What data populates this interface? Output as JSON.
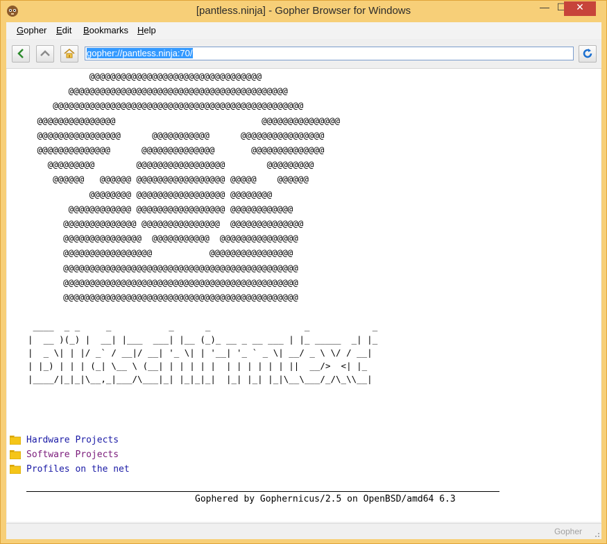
{
  "window": {
    "title": "[pantless.ninja] - Gopher Browser for Windows",
    "controls": {
      "minimize": "—",
      "maximize": "☐",
      "close": "✕"
    }
  },
  "menu": [
    {
      "label": "Gopher",
      "accel": "G",
      "rest": "opher"
    },
    {
      "label": "Edit",
      "accel": "E",
      "rest": "dit"
    },
    {
      "label": "Bookmarks",
      "accel": "B",
      "rest": "ookmarks"
    },
    {
      "label": "Help",
      "accel": "H",
      "rest": "elp"
    }
  ],
  "toolbar": {
    "back_icon": "arrow-left-icon",
    "up_icon": "chevron-up-icon",
    "home_icon": "home-icon",
    "refresh_icon": "refresh-icon",
    "address": "gopher://pantless.ninja:70/"
  },
  "art": {
    "skull": "           @@@@@@@@@@@@@@@@@@@@@@@@@@@@@@@@@\n       @@@@@@@@@@@@@@@@@@@@@@@@@@@@@@@@@@@@@@@@@@\n    @@@@@@@@@@@@@@@@@@@@@@@@@@@@@@@@@@@@@@@@@@@@@@@@\n @@@@@@@@@@@@@@@                            @@@@@@@@@@@@@@@\n @@@@@@@@@@@@@@@@      @@@@@@@@@@@      @@@@@@@@@@@@@@@@\n @@@@@@@@@@@@@@      @@@@@@@@@@@@@@       @@@@@@@@@@@@@@\n   @@@@@@@@@        @@@@@@@@@@@@@@@@@        @@@@@@@@@\n    @@@@@@   @@@@@@ @@@@@@@@@@@@@@@@@ @@@@@    @@@@@@\n           @@@@@@@@ @@@@@@@@@@@@@@@@@ @@@@@@@@\n       @@@@@@@@@@@@ @@@@@@@@@@@@@@@@@ @@@@@@@@@@@@\n      @@@@@@@@@@@@@@ @@@@@@@@@@@@@@@  @@@@@@@@@@@@@@\n      @@@@@@@@@@@@@@@  @@@@@@@@@@@  @@@@@@@@@@@@@@@\n      @@@@@@@@@@@@@@@@@           @@@@@@@@@@@@@@@@\n      @@@@@@@@@@@@@@@@@@@@@@@@@@@@@@@@@@@@@@@@@@@@@\n      @@@@@@@@@@@@@@@@@@@@@@@@@@@@@@@@@@@@@@@@@@@@@\n      @@@@@@@@@@@@@@@@@@@@@@@@@@@@@@@@@@@@@@@@@@@@@",
    "banner": " ____  _ _     _           _      _                  _            _\n|  __ )(_) |  __| |___  ___| |__ (_)_ __ _ __ ___ | |_ _____  _| |_\n|  _ \\| | |/ _` / __|/ __| '_ \\| | '__| '_ ` _ \\| __/ _ \\ \\/ / __|\n| |_) | | | (_| \\__ \\ (__| | | | | |  | | | | | | ||  __/>  <| |_\n|____/|_|_|\\__,_|___/\\___|_| |_|_|_|  |_| |_| |_|\\__\\___/_/\\_\\\\__|"
  },
  "links": [
    {
      "label": "Hardware Projects",
      "color": "#1a1aa6",
      "icon": "folder-icon"
    },
    {
      "label": "Software Projects",
      "color": "#7a1a7a",
      "icon": "folder-icon"
    },
    {
      "label": "Profiles on the net",
      "color": "#1a1aa6",
      "icon": "folder-icon"
    }
  ],
  "footer": "Gophered by Gophernicus/2.5 on OpenBSD/amd64 6.3",
  "status": "Gopher"
}
